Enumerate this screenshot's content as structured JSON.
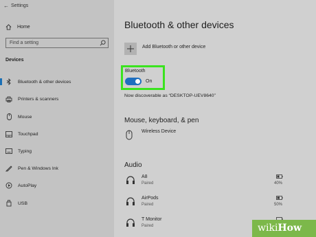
{
  "app": {
    "title": "Settings"
  },
  "sidebar": {
    "home": "Home",
    "search_placeholder": "Find a setting",
    "section": "Devices",
    "items": [
      {
        "label": "Bluetooth & other devices",
        "icon": "bluetooth-icon",
        "active": true
      },
      {
        "label": "Printers & scanners",
        "icon": "printer-icon"
      },
      {
        "label": "Mouse",
        "icon": "mouse-icon"
      },
      {
        "label": "Touchpad",
        "icon": "touchpad-icon"
      },
      {
        "label": "Typing",
        "icon": "keyboard-icon"
      },
      {
        "label": "Pen & Windows Ink",
        "icon": "pen-icon"
      },
      {
        "label": "AutoPlay",
        "icon": "autoplay-icon"
      },
      {
        "label": "USB",
        "icon": "usb-icon"
      }
    ]
  },
  "main": {
    "title": "Bluetooth & other devices",
    "add_device": "Add Bluetooth or other device",
    "bluetooth": {
      "label": "Bluetooth",
      "state": "On"
    },
    "discoverable": "Now discoverable as “DESKTOP-UEV8640”",
    "mkp": {
      "heading": "Mouse, keyboard, & pen",
      "devices": [
        {
          "name": "Wireless Device"
        }
      ]
    },
    "audio": {
      "heading": "Audio",
      "devices": [
        {
          "name": "A8",
          "status": "Paired",
          "battery": "40%"
        },
        {
          "name": "AirPods",
          "status": "Paired",
          "battery": "50%"
        },
        {
          "name": "T Monitor",
          "status": "Paired"
        }
      ]
    }
  },
  "watermark": {
    "wiki": "wiki",
    "how": "How"
  },
  "colors": {
    "toggle_on": "#1f6fbf",
    "highlight": "#3ae31e",
    "watermark": "#7cb84a"
  }
}
